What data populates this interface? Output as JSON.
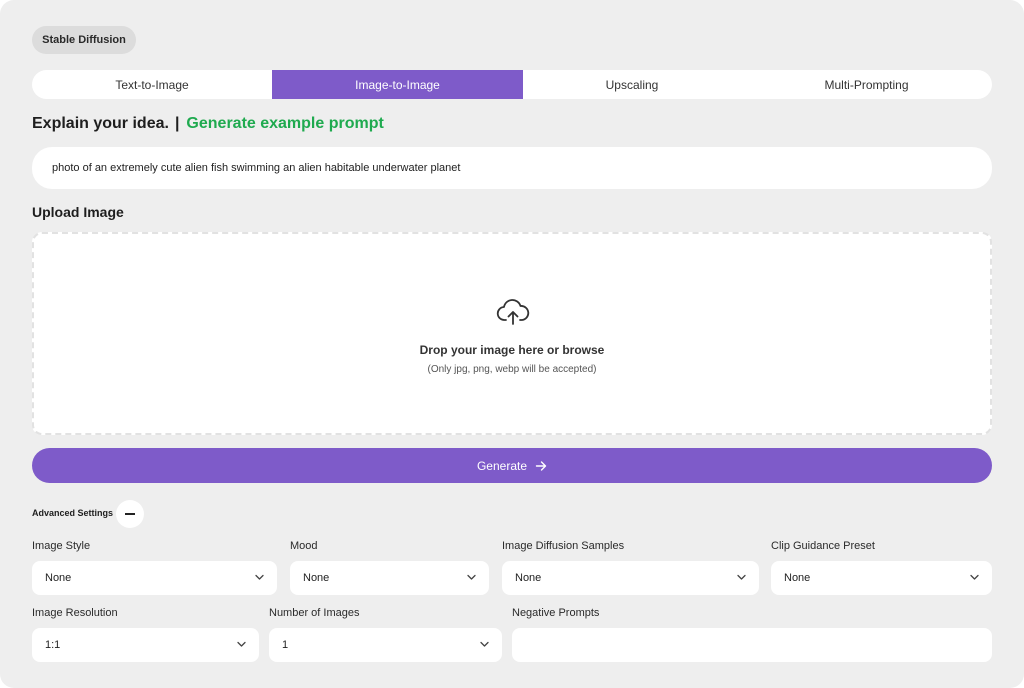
{
  "app": {
    "badge": "Stable Diffusion"
  },
  "tabs": [
    {
      "label": "Text-to-Image",
      "active": false
    },
    {
      "label": "Image-to-Image",
      "active": true
    },
    {
      "label": "Upscaling",
      "active": false
    },
    {
      "label": "Multi-Prompting",
      "active": false
    }
  ],
  "prompt": {
    "title": "Explain your idea.",
    "separator": "|",
    "example_link": "Generate example prompt",
    "value": "photo of an extremely cute alien fish swimming an alien habitable underwater planet"
  },
  "upload": {
    "title": "Upload Image",
    "icon": "cloud-upload-icon",
    "main_text": "Drop your image here or browse",
    "sub_text": "(Only jpg, png, webp will be accepted)"
  },
  "generate": {
    "label": "Generate",
    "icon": "arrow-right-icon"
  },
  "advanced": {
    "label": "Advanced Settings",
    "toggle_icon": "minus-icon",
    "fields": {
      "image_style": {
        "label": "Image Style",
        "value": "None"
      },
      "mood": {
        "label": "Mood",
        "value": "None"
      },
      "diffusion_samples": {
        "label": "Image Diffusion Samples",
        "value": "None"
      },
      "clip_guidance": {
        "label": "Clip Guidance Preset",
        "value": "None"
      },
      "resolution": {
        "label": "Image Resolution",
        "value": "1:1"
      },
      "num_images": {
        "label": "Number of Images",
        "value": "1"
      },
      "negative_prompts": {
        "label": "Negative Prompts",
        "value": ""
      }
    }
  },
  "colors": {
    "accent": "#7e5bc9",
    "link_green": "#1faa4f",
    "panel_bg": "#eeeeee",
    "badge_bg": "#dcdcdc"
  }
}
